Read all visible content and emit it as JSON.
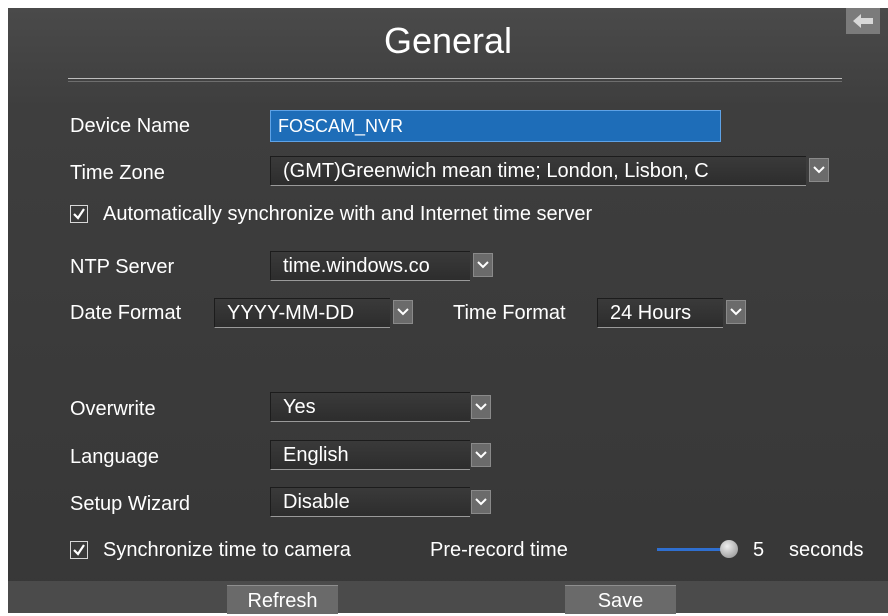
{
  "title": "General",
  "back_icon": "back-arrow-icon",
  "device_name": {
    "label": "Device Name",
    "value": "FOSCAM_NVR"
  },
  "time_zone": {
    "label": "Time Zone",
    "value": "(GMT)Greenwich mean time; London, Lisbon, C"
  },
  "auto_sync": {
    "label": "Automatically synchronize with and Internet time server",
    "checked": true
  },
  "ntp_server": {
    "label": "NTP Server",
    "value": "time.windows.co"
  },
  "date_format": {
    "label": "Date Format",
    "value": "YYYY-MM-DD"
  },
  "time_format": {
    "label": "Time Format",
    "value": "24 Hours"
  },
  "overwrite": {
    "label": "Overwrite",
    "value": "Yes"
  },
  "language": {
    "label": "Language",
    "value": "English"
  },
  "setup_wizard": {
    "label": "Setup Wizard",
    "value": "Disable"
  },
  "sync_camera": {
    "label": "Synchronize time to camera",
    "checked": true
  },
  "pre_record": {
    "label": "Pre-record time",
    "value": "5",
    "unit": "seconds"
  },
  "buttons": {
    "refresh": "Refresh",
    "save": "Save"
  },
  "colors": {
    "panel": "#3e3e3e",
    "input_active": "#1e6db8",
    "slider": "#2f6fd0"
  }
}
